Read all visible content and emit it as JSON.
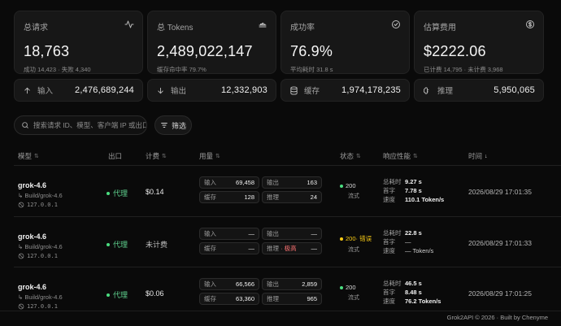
{
  "stats": [
    {
      "label": "总请求",
      "value": "18,763",
      "sub": "成功 14,423 · 失败 4,340",
      "icon": "activity-icon"
    },
    {
      "label": "总 Tokens",
      "value": "2,489,022,147",
      "sub": "缓存命中率 79.7%",
      "icon": "layers-icon"
    },
    {
      "label": "成功率",
      "value": "76.9%",
      "sub": "平均耗时 31.8 s",
      "icon": "check-circle-icon"
    },
    {
      "label": "估算费用",
      "value": "$2222.06",
      "sub": "已计费 14,795 · 未计费 3,968",
      "icon": "dollar-circle-icon"
    }
  ],
  "tokens": [
    {
      "label": "输入",
      "value": "2,476,689,244",
      "icon": "arrow-up-icon"
    },
    {
      "label": "输出",
      "value": "12,332,903",
      "icon": "arrow-down-icon"
    },
    {
      "label": "缓存",
      "value": "1,974,178,235",
      "icon": "database-icon"
    },
    {
      "label": "推理",
      "value": "5,950,065",
      "icon": "brain-icon"
    }
  ],
  "search": {
    "placeholder": "搜索请求 ID、模型、客户端 IP 或出口"
  },
  "filter": {
    "label": "筛选"
  },
  "columns": {
    "model": "模型",
    "egress": "出口",
    "cost": "计费",
    "usage": "用量",
    "status": "状态",
    "perf": "响应性能",
    "time": "时间"
  },
  "usage_labels": {
    "input": "输入",
    "output": "输出",
    "cache": "缓存",
    "reasoning": "推理"
  },
  "perf_labels": {
    "total": "总耗时",
    "first": "首字",
    "speed": "速度"
  },
  "rows": [
    {
      "model": "grok-4.6",
      "upstream": "Build/grok-4.6",
      "ip": "127.0.0.1",
      "egress": "代理",
      "cost": "$0.14",
      "input": "69,458",
      "output": "163",
      "cache": "128",
      "reasoning": "24",
      "reasoning_flag": "",
      "status_code": "200",
      "status_extra": "",
      "status_mode": "流式",
      "status_color": "#4ade80",
      "total": "9.27 s",
      "first": "7.78 s",
      "speed": "110.1 Token/s",
      "time": "2026/08/29 17:01:35"
    },
    {
      "model": "grok-4.6",
      "upstream": "Build/grok-4.6",
      "ip": "127.0.0.1",
      "egress": "代理",
      "cost": "未计费",
      "input": "—",
      "output": "—",
      "cache": "—",
      "reasoning": "—",
      "reasoning_flag": "· 极高",
      "status_code": "200",
      "status_extra": " · 错误",
      "status_mode": "流式",
      "status_color": "#facc15",
      "total": "22.8 s",
      "first": "—",
      "speed": "— Token/s",
      "time": "2026/08/29 17:01:33"
    },
    {
      "model": "grok-4.6",
      "upstream": "Build/grok-4.6",
      "ip": "127.0.0.1",
      "egress": "代理",
      "cost": "$0.06",
      "input": "66,566",
      "output": "2,859",
      "cache": "63,360",
      "reasoning": "965",
      "reasoning_flag": "",
      "status_code": "200",
      "status_extra": "",
      "status_mode": "流式",
      "status_color": "#4ade80",
      "total": "46.5 s",
      "first": "8.48 s",
      "speed": "76.2 Token/s",
      "time": "2026/08/29 17:01:25"
    }
  ],
  "footer": {
    "text": "Grok2API © 2026 · Built by Chenyme"
  }
}
